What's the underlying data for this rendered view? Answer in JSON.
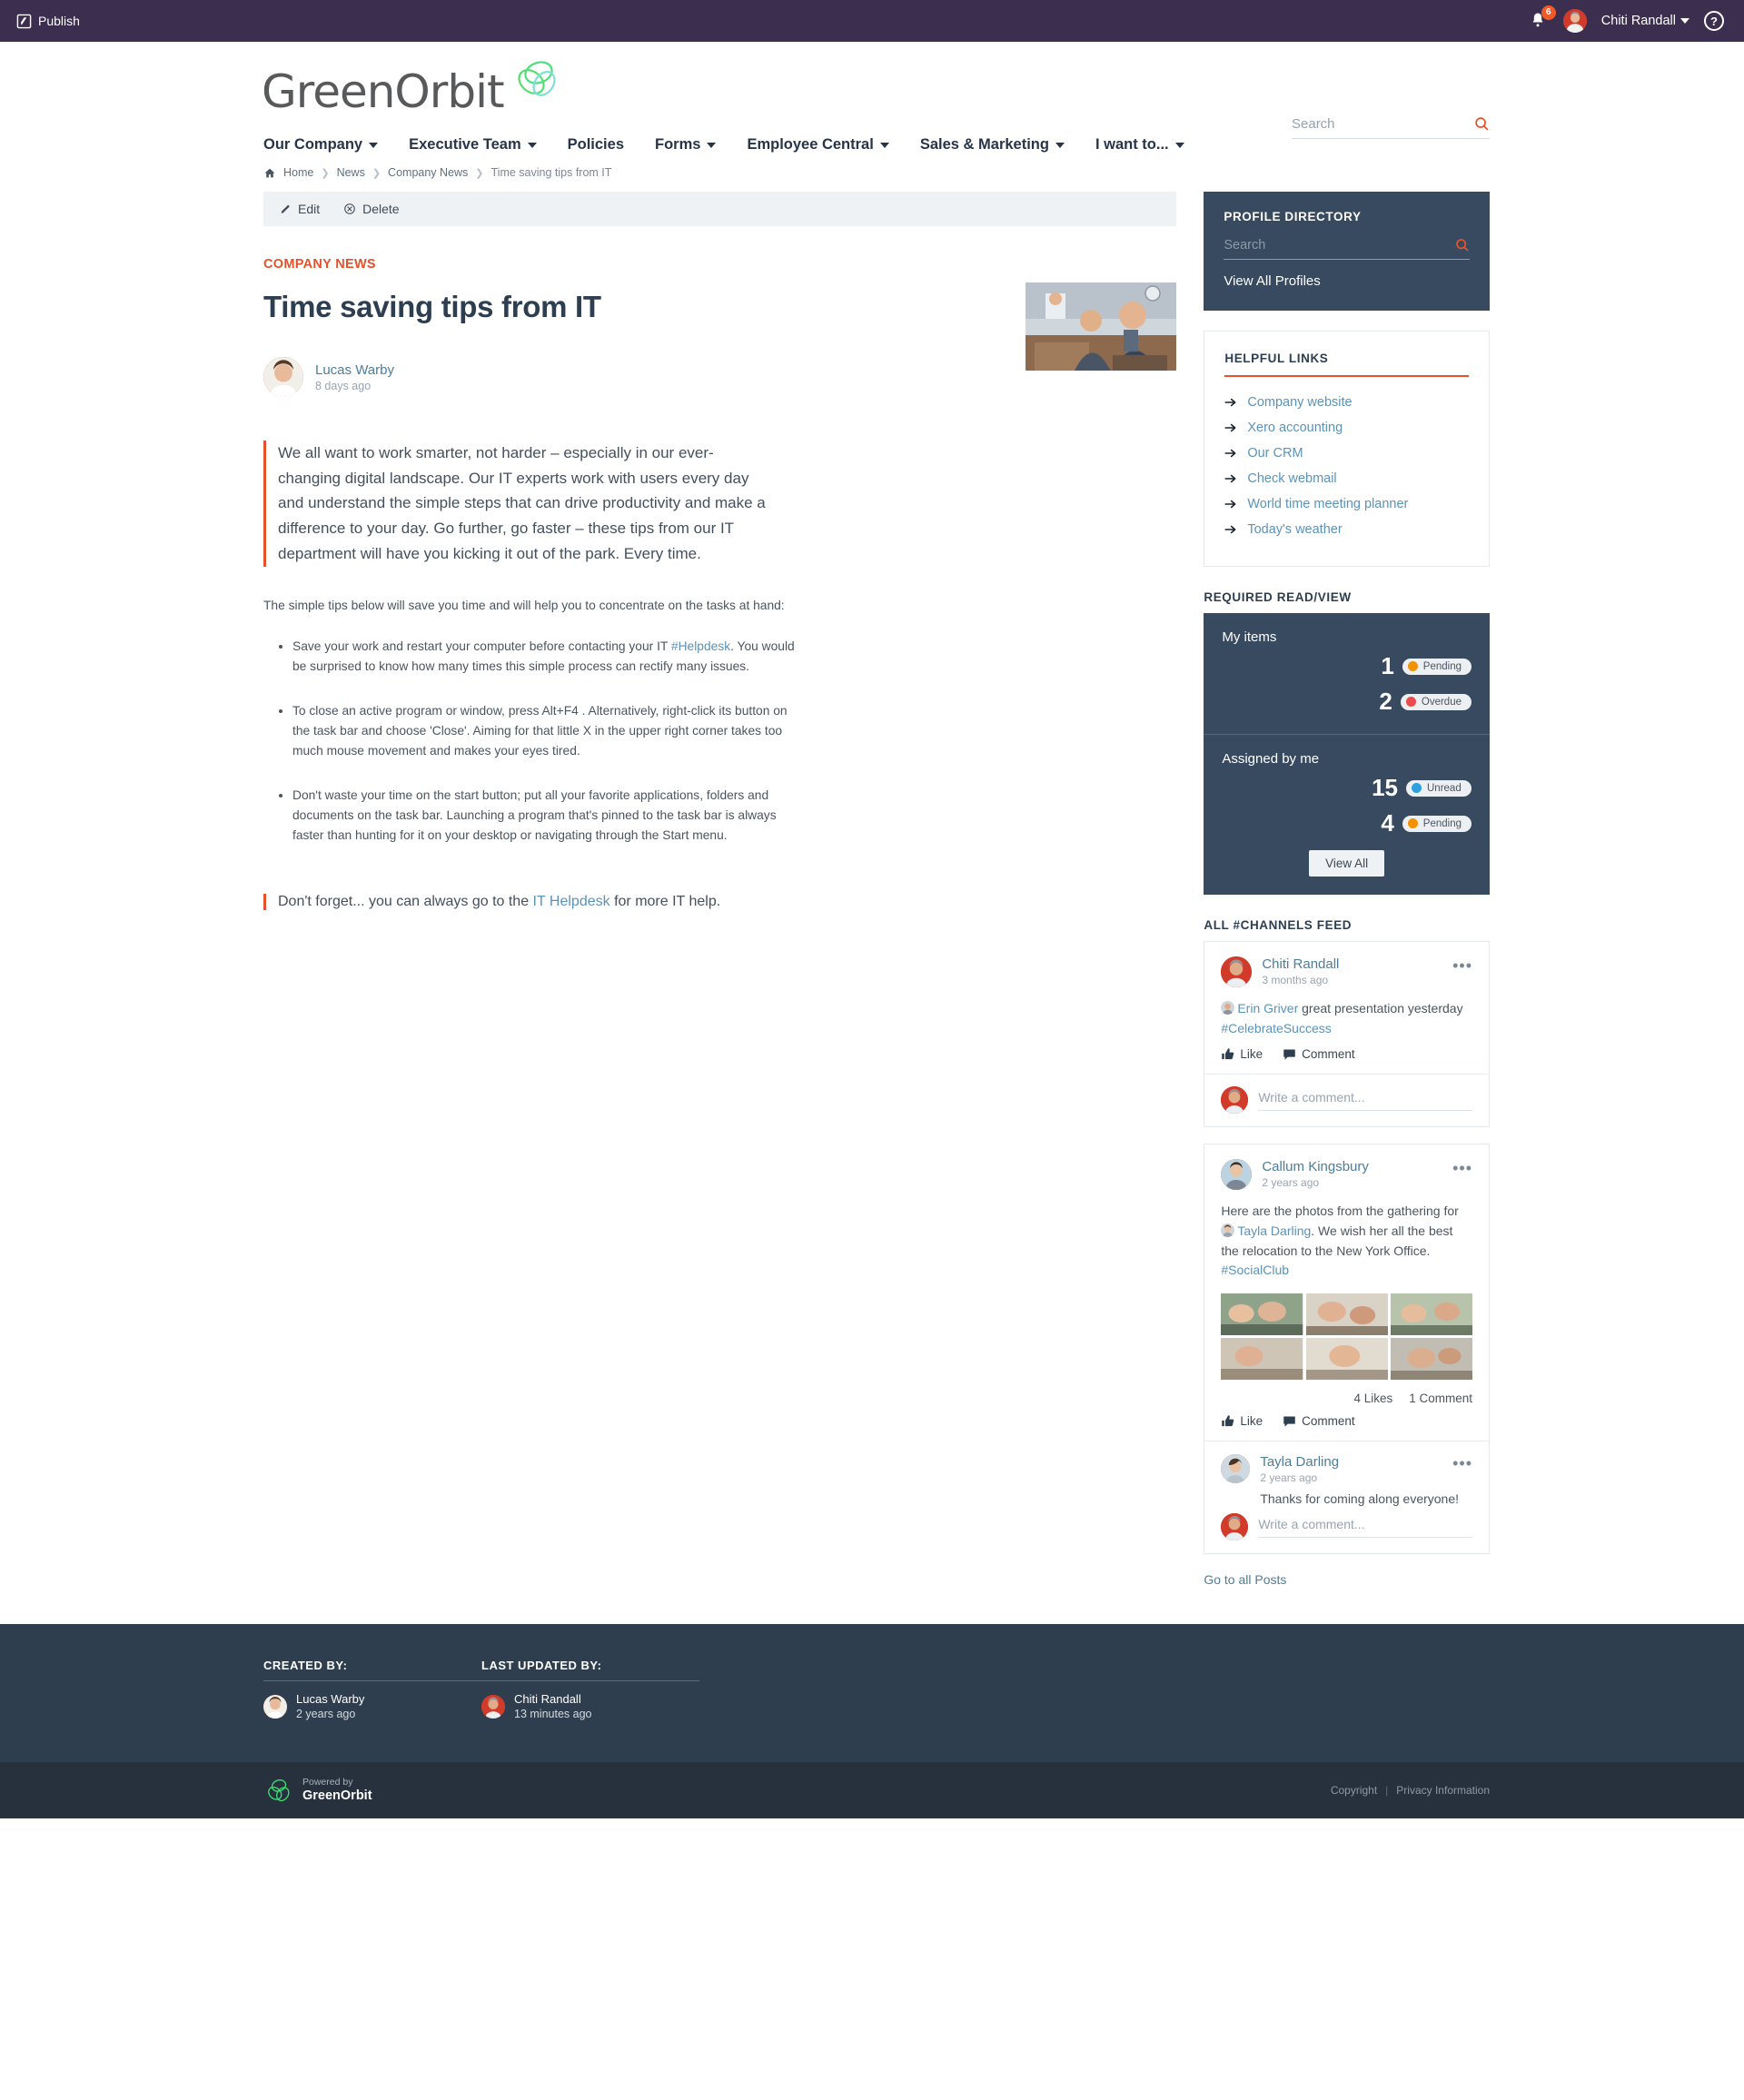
{
  "topbar": {
    "publish_label": "Publish",
    "notifications_count": "6",
    "user_name": "Chiti Randall",
    "help_label": "?"
  },
  "header": {
    "logo_text": "GreenOrbit",
    "search_placeholder": "Search"
  },
  "nav": [
    {
      "label": "Our Company",
      "has_caret": true
    },
    {
      "label": "Executive Team",
      "has_caret": true
    },
    {
      "label": "Policies",
      "has_caret": false
    },
    {
      "label": "Forms",
      "has_caret": true
    },
    {
      "label": "Employee Central",
      "has_caret": true
    },
    {
      "label": "Sales & Marketing",
      "has_caret": true
    },
    {
      "label": "I want to...",
      "has_caret": true
    }
  ],
  "breadcrumb": {
    "items": [
      "Home",
      "News",
      "Company News"
    ],
    "current": "Time saving tips from IT"
  },
  "toolbar": {
    "edit_label": "Edit",
    "delete_label": "Delete"
  },
  "article": {
    "category": "COMPANY NEWS",
    "title": "Time saving tips from IT",
    "author": "Lucas Warby",
    "published": "8 days ago",
    "pullquote": "We all want to work smarter, not harder – especially in our ever-changing digital landscape. Our IT experts work with users every day and understand the simple steps that can drive productivity and make a difference to your day. Go further, go faster – these tips from our IT department will have you kicking it out of the park. Every time.",
    "intro": "The simple tips below will save you time and will help you to concentrate on the tasks at hand:",
    "tips": [
      {
        "before": "Save your work and restart your computer before contacting your IT ",
        "link": "#Helpdesk",
        "after": ". You would be surprised to know how many times this simple process can rectify many issues."
      },
      {
        "before": "To close an active program or window, press Alt+F4 . Alternatively, right-click its button on the task bar and choose 'Close'. Aiming for that little X in the upper right corner takes too much mouse movement and makes your eyes tired.",
        "link": "",
        "after": ""
      },
      {
        "before": "Don't waste your time on the start button; put all your favorite applications, folders and documents on the task bar. Launching a program that's pinned to the task bar is always faster than hunting for it on your desktop or navigating through the Start menu.",
        "link": "",
        "after": ""
      }
    ],
    "footnote_before": "Don't forget... you can always go to the ",
    "footnote_link": "IT Helpdesk",
    "footnote_after": " for more IT help."
  },
  "profile_directory": {
    "title": "PROFILE DIRECTORY",
    "search_placeholder": "Search",
    "view_all_label": "View All Profiles"
  },
  "helpful_links": {
    "title": "HELPFUL LINKS",
    "items": [
      "Company website",
      "Xero accounting",
      "Our CRM",
      "Check webmail",
      "World time meeting planner",
      "Today's weather"
    ]
  },
  "required_read": {
    "title": "REQUIRED READ/VIEW",
    "my_items_label": "My items",
    "my_items": [
      {
        "count": "1",
        "status": "Pending",
        "color": "#f39200"
      },
      {
        "count": "2",
        "status": "Overdue",
        "color": "#ea4b4b"
      }
    ],
    "assigned_label": "Assigned by me",
    "assigned": [
      {
        "count": "15",
        "status": "Unread",
        "color": "#2e9fe0"
      },
      {
        "count": "4",
        "status": "Pending",
        "color": "#f39200"
      }
    ],
    "view_all_label": "View All"
  },
  "channels_feed": {
    "title": "ALL #CHANNELS FEED",
    "posts": [
      {
        "author": "Chiti Randall",
        "time": "3 months ago",
        "mention": "Erin Griver",
        "text_after_mention": " great presentation yesterday ",
        "hashtag": "#CelebrateSuccess",
        "like_label": "Like",
        "comment_label": "Comment",
        "comment_placeholder": "Write a comment..."
      },
      {
        "author": "Callum Kingsbury",
        "time": "2 years ago",
        "text_before": "Here are the photos from the gathering for ",
        "mention": "Tayla Darling",
        "text_middle": ". We wish her all the best the relocation to the New York Office. ",
        "hashtag": "#SocialClub",
        "likes": "4 Likes",
        "comments": "1 Comment",
        "like_label": "Like",
        "comment_label": "Comment",
        "reply": {
          "author": "Tayla Darling",
          "time": "2 years ago",
          "text": "Thanks for coming along everyone!"
        },
        "comment_placeholder": "Write a comment..."
      }
    ],
    "go_to_all_label": "Go to all Posts"
  },
  "meta_footer": {
    "created_by_label": "CREATED BY:",
    "created_by_name": "Lucas Warby",
    "created_by_time": "2 years ago",
    "updated_by_label": "LAST UPDATED BY:",
    "updated_by_name": "Chiti Randall",
    "updated_by_time": "13 minutes ago"
  },
  "bottombar": {
    "powered_by": "Powered by",
    "brand": "GreenOrbit",
    "copyright_label": "Copyright",
    "privacy_label": "Privacy Information"
  },
  "colors": {
    "topbar": "#3b2e4e",
    "accent_orange": "#e8502a",
    "panel_dark": "#384a60",
    "link_blue": "#5b93b8"
  }
}
